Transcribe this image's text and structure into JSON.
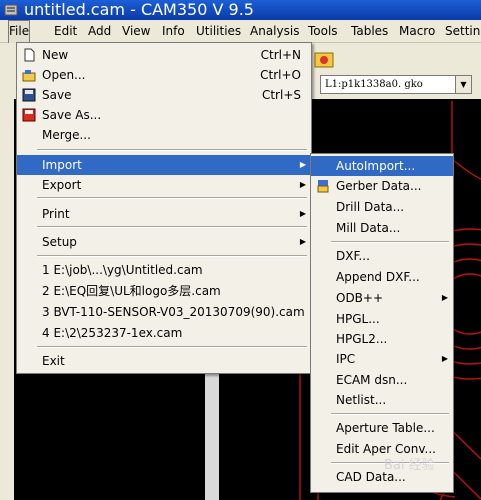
{
  "window": {
    "title": "untitled.cam - CAM350 V 9.5"
  },
  "menubar": [
    {
      "label": "File",
      "key": "file"
    },
    {
      "label": "Edit",
      "key": "edit"
    },
    {
      "label": "Add",
      "key": "add"
    },
    {
      "label": "View",
      "key": "view"
    },
    {
      "label": "Info",
      "key": "info"
    },
    {
      "label": "Utilities",
      "key": "utilities"
    },
    {
      "label": "Analysis",
      "key": "analysis"
    },
    {
      "label": "Tools",
      "key": "tools"
    },
    {
      "label": "Tables",
      "key": "tables"
    },
    {
      "label": "Macro",
      "key": "macro"
    },
    {
      "label": "Settin",
      "key": "settings"
    }
  ],
  "toolbar": {
    "layer_select": "L1:p1k1338a0. gko"
  },
  "file_menu": [
    {
      "label": "New",
      "shortcut": "Ctrl+N",
      "icon": "new-file-icon"
    },
    {
      "label": "Open...",
      "shortcut": "Ctrl+O",
      "icon": "open-folder-icon"
    },
    {
      "label": "Save",
      "shortcut": "Ctrl+S",
      "icon": "save-disk-icon"
    },
    {
      "label": "Save As...",
      "shortcut": "",
      "icon": "save-as-icon"
    },
    {
      "label": "Merge...",
      "shortcut": ""
    },
    {
      "label": "Import",
      "submenu": true
    },
    {
      "label": "Export",
      "submenu": true
    },
    {
      "label": "Print",
      "submenu": true
    },
    {
      "label": "Setup",
      "submenu": true
    },
    {
      "label": "1 E:\\job\\...\\yg\\Untitled.cam"
    },
    {
      "label": "2 E:\\EQ回复\\UL和logo多层.cam"
    },
    {
      "label": "3 BVT-110-SENSOR-V03_20130709(90).cam"
    },
    {
      "label": "4 E:\\2\\253237-1ex.cam"
    },
    {
      "label": "Exit"
    }
  ],
  "import_menu": [
    {
      "label": "AutoImport..."
    },
    {
      "label": "Gerber Data...",
      "icon": "gerber-icon"
    },
    {
      "label": "Drill Data..."
    },
    {
      "label": "Mill Data..."
    },
    {
      "label": "DXF..."
    },
    {
      "label": "Append DXF..."
    },
    {
      "label": "ODB++",
      "submenu": true
    },
    {
      "label": "HPGL..."
    },
    {
      "label": "HPGL2..."
    },
    {
      "label": "IPC",
      "submenu": true
    },
    {
      "label": "ECAM dsn..."
    },
    {
      "label": "Netlist..."
    },
    {
      "label": "Aperture Table..."
    },
    {
      "label": "Edit Aper Conv..."
    },
    {
      "label": "CAD Data..."
    }
  ],
  "watermark": "Bai 经验"
}
